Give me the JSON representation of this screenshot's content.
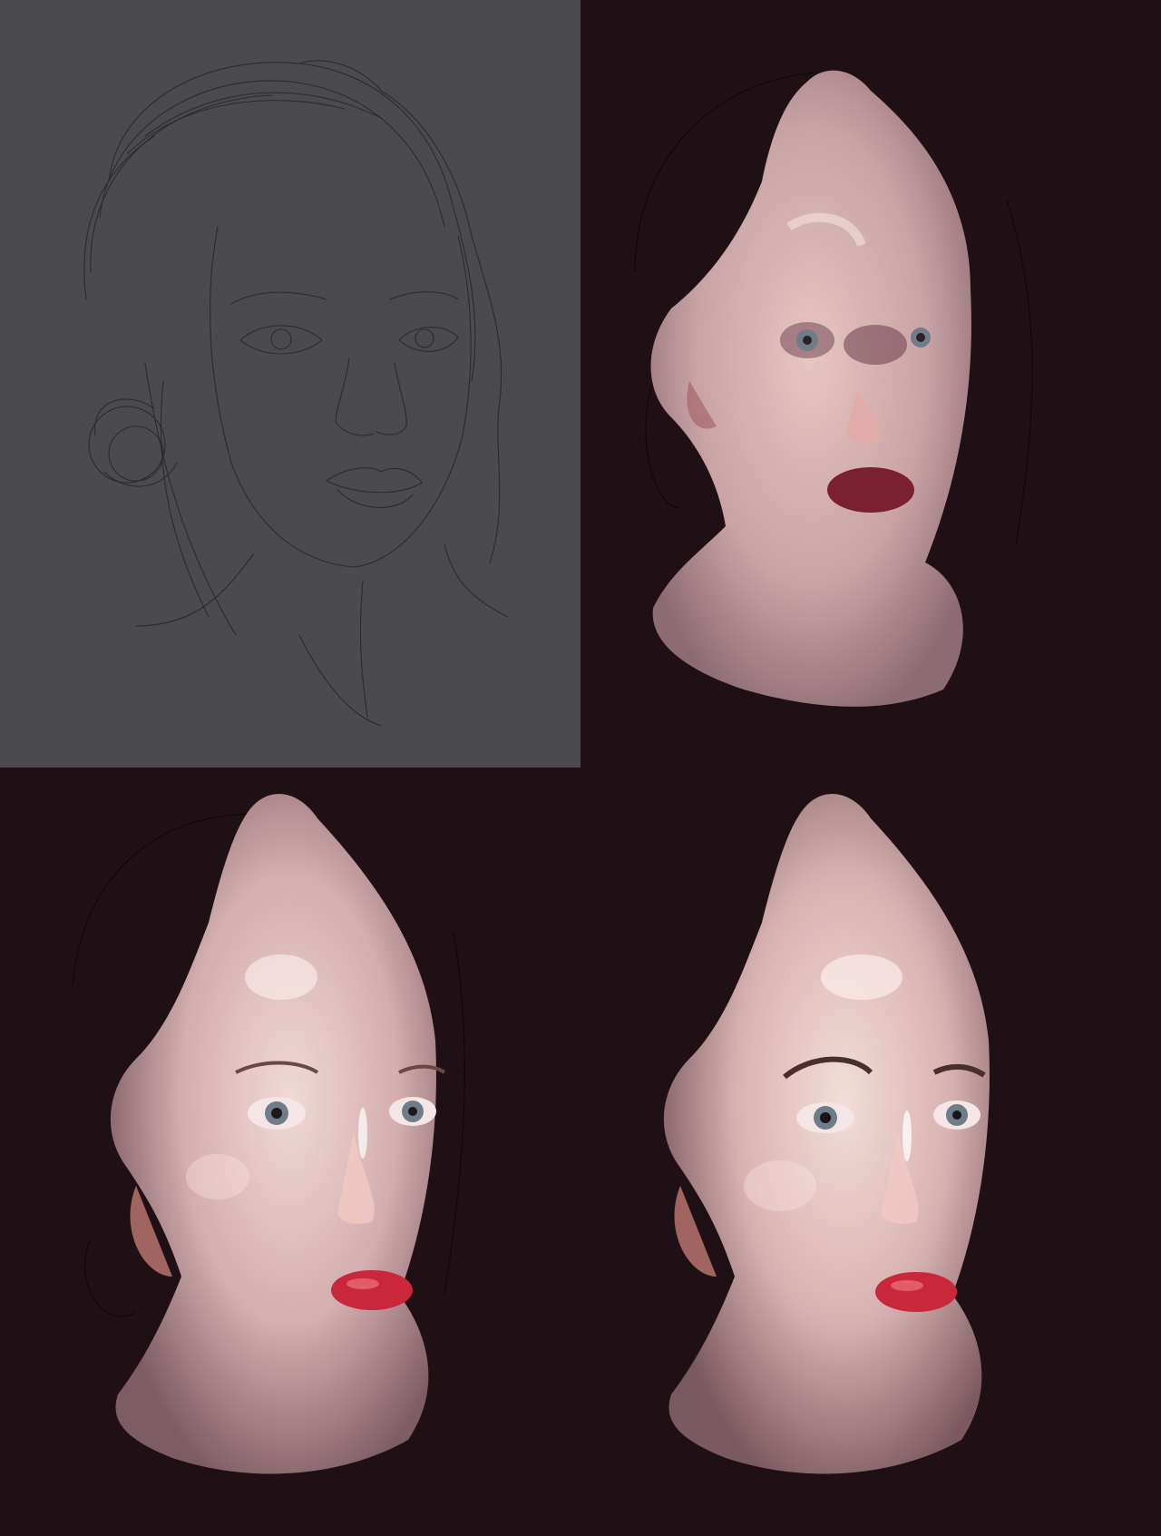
{
  "colors": {
    "background": "#1f1016",
    "sketch_panel": "#4b4b4d",
    "sketch_line": "#2c2c2e",
    "skin_light": "#e9cfcf",
    "skin_mid": "#c7a6a8",
    "skin_shadow": "#8d6a70",
    "lip_stage2": "#7a2030",
    "lip_stage3": "#c8283a",
    "iris": "#6f7d88"
  },
  "panels": [
    {
      "id": "sketch",
      "stage": "line-sketch",
      "position": "top-left"
    },
    {
      "id": "blockin",
      "stage": "color-block-in",
      "position": "top-right"
    },
    {
      "id": "rendering",
      "stage": "rendering",
      "position": "bottom-left"
    },
    {
      "id": "final",
      "stage": "final-polish",
      "position": "bottom-right"
    }
  ]
}
